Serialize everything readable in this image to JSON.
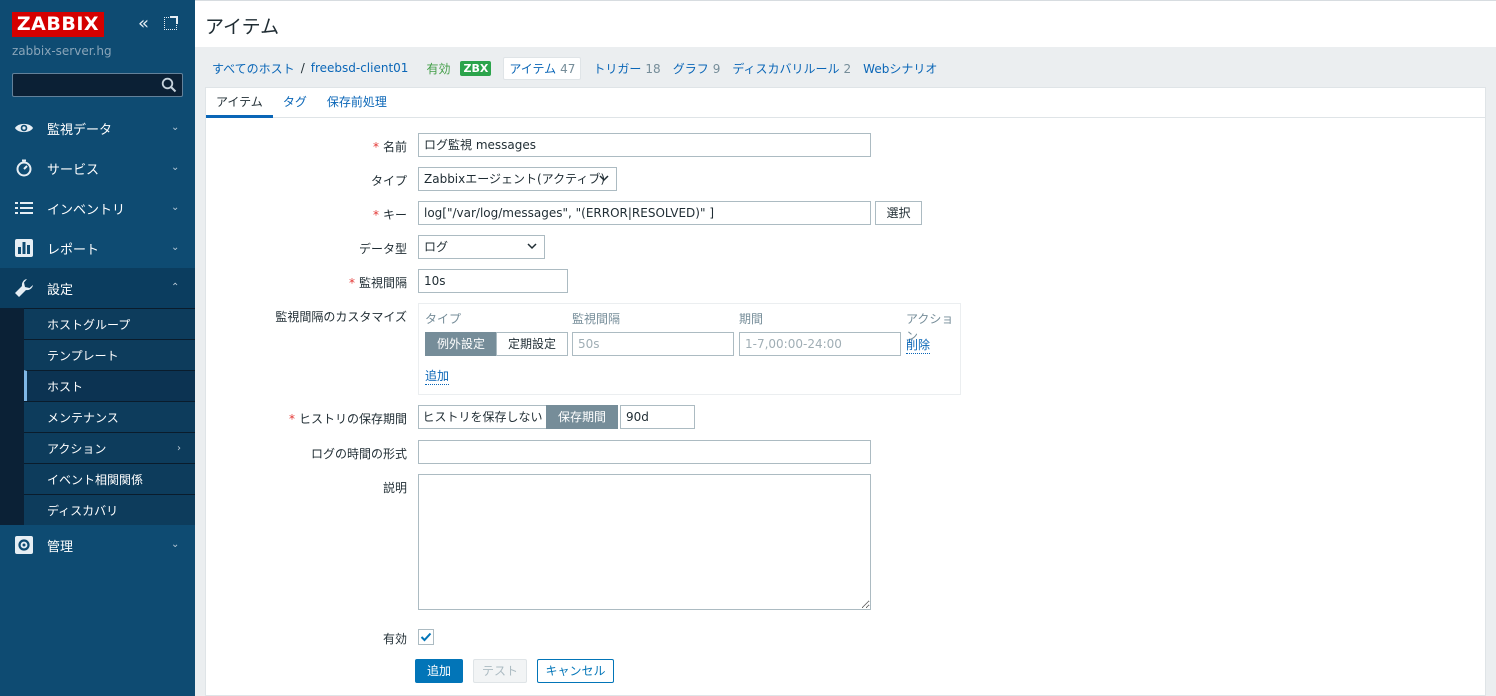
{
  "sidebar": {
    "logo": "ZABBIX",
    "server_name": "zabbix-server.hg",
    "search_placeholder": "",
    "menu": [
      {
        "label": "監視データ",
        "icon": "eye-icon"
      },
      {
        "label": "サービス",
        "icon": "clock-icon"
      },
      {
        "label": "インベントリ",
        "icon": "list-icon"
      },
      {
        "label": "レポート",
        "icon": "bar-chart-icon"
      },
      {
        "label": "設定",
        "icon": "wrench-icon"
      },
      {
        "label": "管理",
        "icon": "gear-icon"
      }
    ],
    "submenu": [
      "ホストグループ",
      "テンプレート",
      "ホスト",
      "メンテナンス",
      "アクション",
      "イベント相関関係",
      "ディスカバリ"
    ]
  },
  "page": {
    "title": "アイテム"
  },
  "breadcrumbs": {
    "all_hosts": "すべてのホスト",
    "separator": "/",
    "host": "freebsd-client01",
    "status": "有効",
    "badge": "ZBX",
    "items": {
      "label": "アイテム",
      "count": "47"
    },
    "triggers": {
      "label": "トリガー",
      "count": "18"
    },
    "graphs": {
      "label": "グラフ",
      "count": "9"
    },
    "discovery": {
      "label": "ディスカバリルール",
      "count": "2"
    },
    "web": {
      "label": "Webシナリオ"
    }
  },
  "tabs": [
    "アイテム",
    "タグ",
    "保存前処理"
  ],
  "form": {
    "name_label": "名前",
    "name_value": "ログ監視 messages",
    "type_label": "タイプ",
    "type_value": "Zabbixエージェント(アクティブ)",
    "key_label": "キー",
    "key_value": "log[\"/var/log/messages\", \"(ERROR|RESOLVED)\" ]",
    "select_button": "選択",
    "datatype_label": "データ型",
    "datatype_value": "ログ",
    "interval_label": "監視間隔",
    "interval_value": "10s",
    "custom_label": "監視間隔のカスタマイズ",
    "custom": {
      "col_type": "タイプ",
      "col_interval": "監視間隔",
      "col_period": "期間",
      "col_action": "アクション",
      "flexible": "例外設定",
      "scheduling": "定期設定",
      "interval_placeholder": "50s",
      "period_placeholder": "1-7,00:00-24:00",
      "remove": "削除",
      "add": "追加"
    },
    "history_label": "ヒストリの保存期間",
    "history_nostore": "ヒストリを保存しない",
    "history_store": "保存期間",
    "history_value": "90d",
    "logtime_label": "ログの時間の形式",
    "logtime_value": "",
    "description_label": "説明",
    "description_value": "",
    "enabled_label": "有効",
    "enabled": true
  },
  "buttons": {
    "add": "追加",
    "test": "テスト",
    "cancel": "キャンセル"
  },
  "colors": {
    "sidebar": "#0e4b72",
    "logo": "#d40000",
    "link": "#0a66b7",
    "primary": "#0275b8",
    "enabled": "#429e47",
    "badge": "#2ba44b"
  }
}
